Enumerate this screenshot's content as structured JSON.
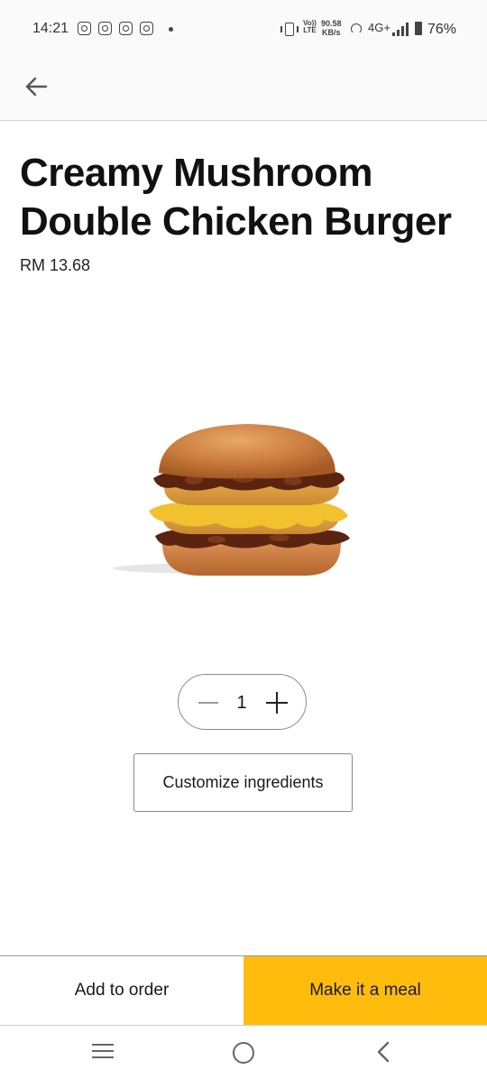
{
  "status_bar": {
    "time": "14:21",
    "notification_icons": [
      "instagram-icon",
      "instagram-icon",
      "instagram-icon",
      "instagram-icon"
    ],
    "volte_top": "Vo))",
    "volte_bottom": "LTE",
    "speed_value": "90.58",
    "speed_unit": "KB/s",
    "network": "4G+",
    "battery": "76%"
  },
  "header": {
    "back_icon": "arrow-left-icon"
  },
  "product": {
    "title": "Creamy Mushroom Double Chicken Burger",
    "price": "RM 13.68",
    "image_icon": "burger-image"
  },
  "quantity": {
    "value": "1",
    "minus_icon": "minus-icon",
    "plus_icon": "plus-icon"
  },
  "customize": {
    "label": "Customize ingredients"
  },
  "actions": {
    "add_to_order": "Add to order",
    "make_meal": "Make it a meal"
  },
  "colors": {
    "accent": "#ffbc0d",
    "header_bg": "#fafafa"
  },
  "nav_bar": {
    "recents_icon": "recents-icon",
    "home_icon": "home-icon",
    "back_icon": "back-icon"
  }
}
